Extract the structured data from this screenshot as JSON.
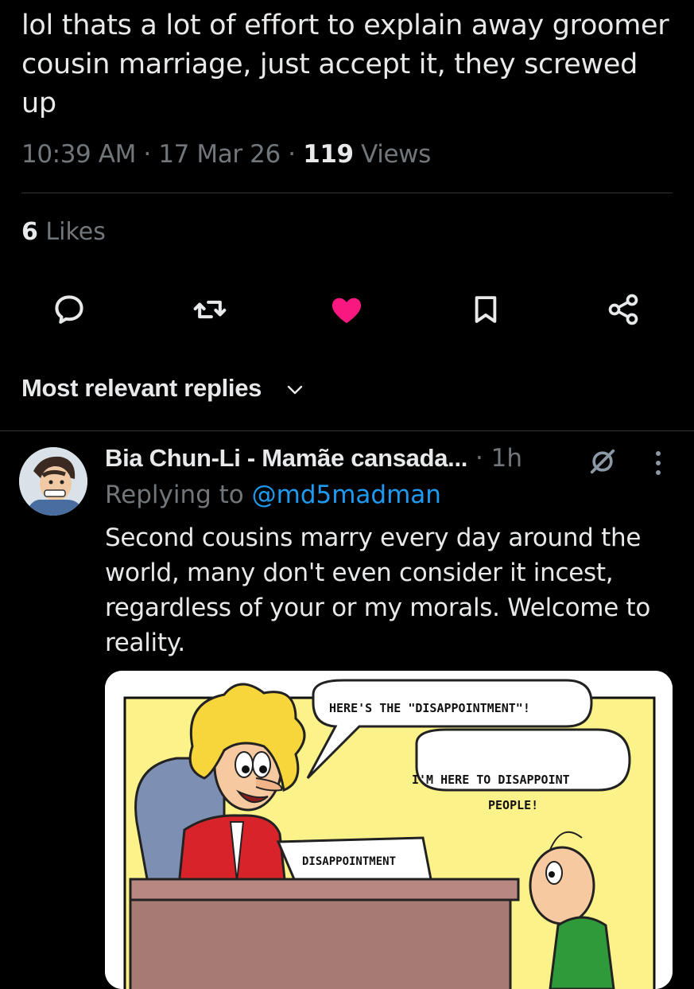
{
  "tweet": {
    "text": "lol thats a lot of effort to explain away groomer cousin marriage, just accept it, they screwed up",
    "time": "10:39 AM",
    "sep1": " · ",
    "date": "17 Mar 26",
    "sep2": " · ",
    "views_count": "119",
    "views_label": " Views",
    "likes_count": "6",
    "likes_label": " Likes"
  },
  "actions": {
    "reply": "reply-icon",
    "retweet": "retweet-icon",
    "like": "heart-filled-icon",
    "bookmark": "bookmark-icon",
    "share": "share-icon",
    "like_color": "#f91880"
  },
  "replies_sort": {
    "label": "Most relevant replies"
  },
  "reply": {
    "author_name": "Bia Chun-Li - Mamãe cansada...",
    "time": " · 1h",
    "replying_prefix": "Replying to ",
    "replying_handle": "@md5madman",
    "text": "Second cousins marry every day around the world, many don't even consider it incest, regardless of your or my morals. Welcome to reality.",
    "image": {
      "bubble1": "HERE'S THE \"DISAPPOINTMENT\"!",
      "bubble2_line1": "I'M HERE TO DISAPPOINT",
      "bubble2_line2": "PEOPLE!",
      "desk_sign": "DISAPPOINTMENT"
    }
  },
  "colors": {
    "background": "#000000",
    "text": "#e7e9ea",
    "muted": "#71767b",
    "link": "#1d9bf0",
    "divider": "#2f3336"
  }
}
